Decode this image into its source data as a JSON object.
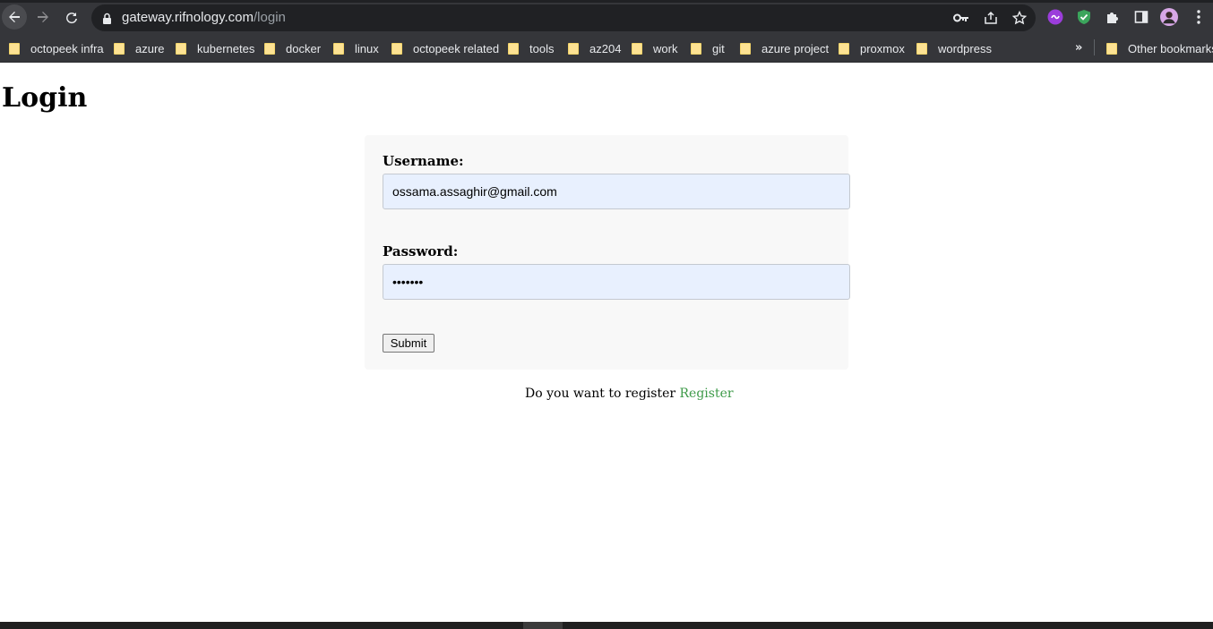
{
  "browser": {
    "url_host": "gateway.rifnology.com",
    "url_path": "/login"
  },
  "bookmarks": [
    {
      "label": "octopeek infra"
    },
    {
      "label": "azure"
    },
    {
      "label": "kubernetes"
    },
    {
      "label": "docker"
    },
    {
      "label": "linux"
    },
    {
      "label": "octopeek related"
    },
    {
      "label": "tools"
    },
    {
      "label": "az204"
    },
    {
      "label": "work"
    },
    {
      "label": "git"
    },
    {
      "label": "azure project"
    },
    {
      "label": "proxmox"
    },
    {
      "label": "wordpress"
    }
  ],
  "bookmarks_more": "»",
  "other_bookmarks": "Other bookmarks",
  "page": {
    "title": "Login",
    "username_label": "Username:",
    "username_value": "ossama.assaghir@gmail.com",
    "password_label": "Password:",
    "password_value": "•••••••",
    "submit_label": "Submit",
    "register_prompt": "Do you want to register",
    "register_link": "Register"
  },
  "colors": {
    "chrome_bg": "#35363a",
    "omnibox_bg": "#202124",
    "autofill_bg": "#e8f0fe",
    "link": "#3d9a48",
    "card_bg": "#f8f8f8"
  }
}
